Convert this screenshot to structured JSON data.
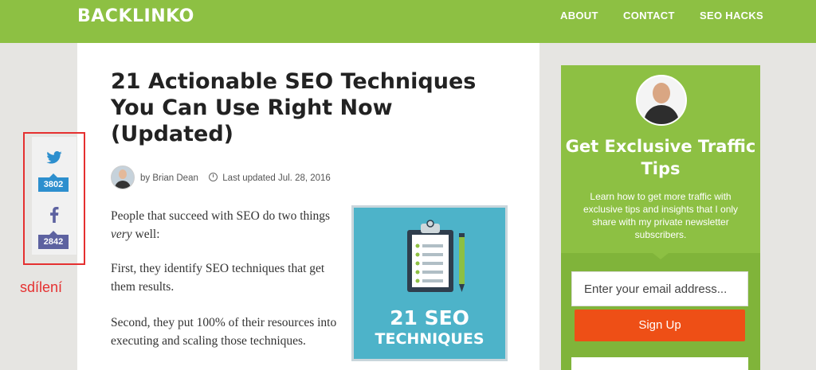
{
  "header": {
    "logo": "BACKLINKO",
    "nav": [
      "ABOUT",
      "CONTACT",
      "SEO HACKS"
    ]
  },
  "article": {
    "title": "21 Actionable SEO Techniques You Can Use Right Now (Updated)",
    "author": "by Brian Dean",
    "updated": "Last updated Jul. 28, 2016",
    "paragraphs": [
      {
        "before": "People that succeed with SEO do two things ",
        "em": "very",
        "after": " well:"
      },
      {
        "text": "First, they identify SEO techniques that get them results."
      },
      {
        "text": "Second, they put 100% of their resources into executing and scaling those techniques."
      }
    ],
    "hero": {
      "line1": "21 SEO",
      "line2": "TECHNIQUES",
      "bg": "#4db3c9"
    }
  },
  "share": {
    "twitter_count": "3802",
    "facebook_count": "2842",
    "annotation": "sdílení",
    "twitter_color": "#2d8fce",
    "facebook_color": "#5d62a0"
  },
  "sidebar": {
    "title": "Get Exclusive Traffic Tips",
    "description": "Learn how to get more traffic with exclusive tips and insights that I only share with my private newsletter subscribers.",
    "email_placeholder": "Enter your email address...",
    "button": "Sign Up"
  },
  "colors": {
    "brand_green": "#8dc043",
    "cta_orange": "#ee4f16",
    "annotation_red": "#e53030"
  }
}
